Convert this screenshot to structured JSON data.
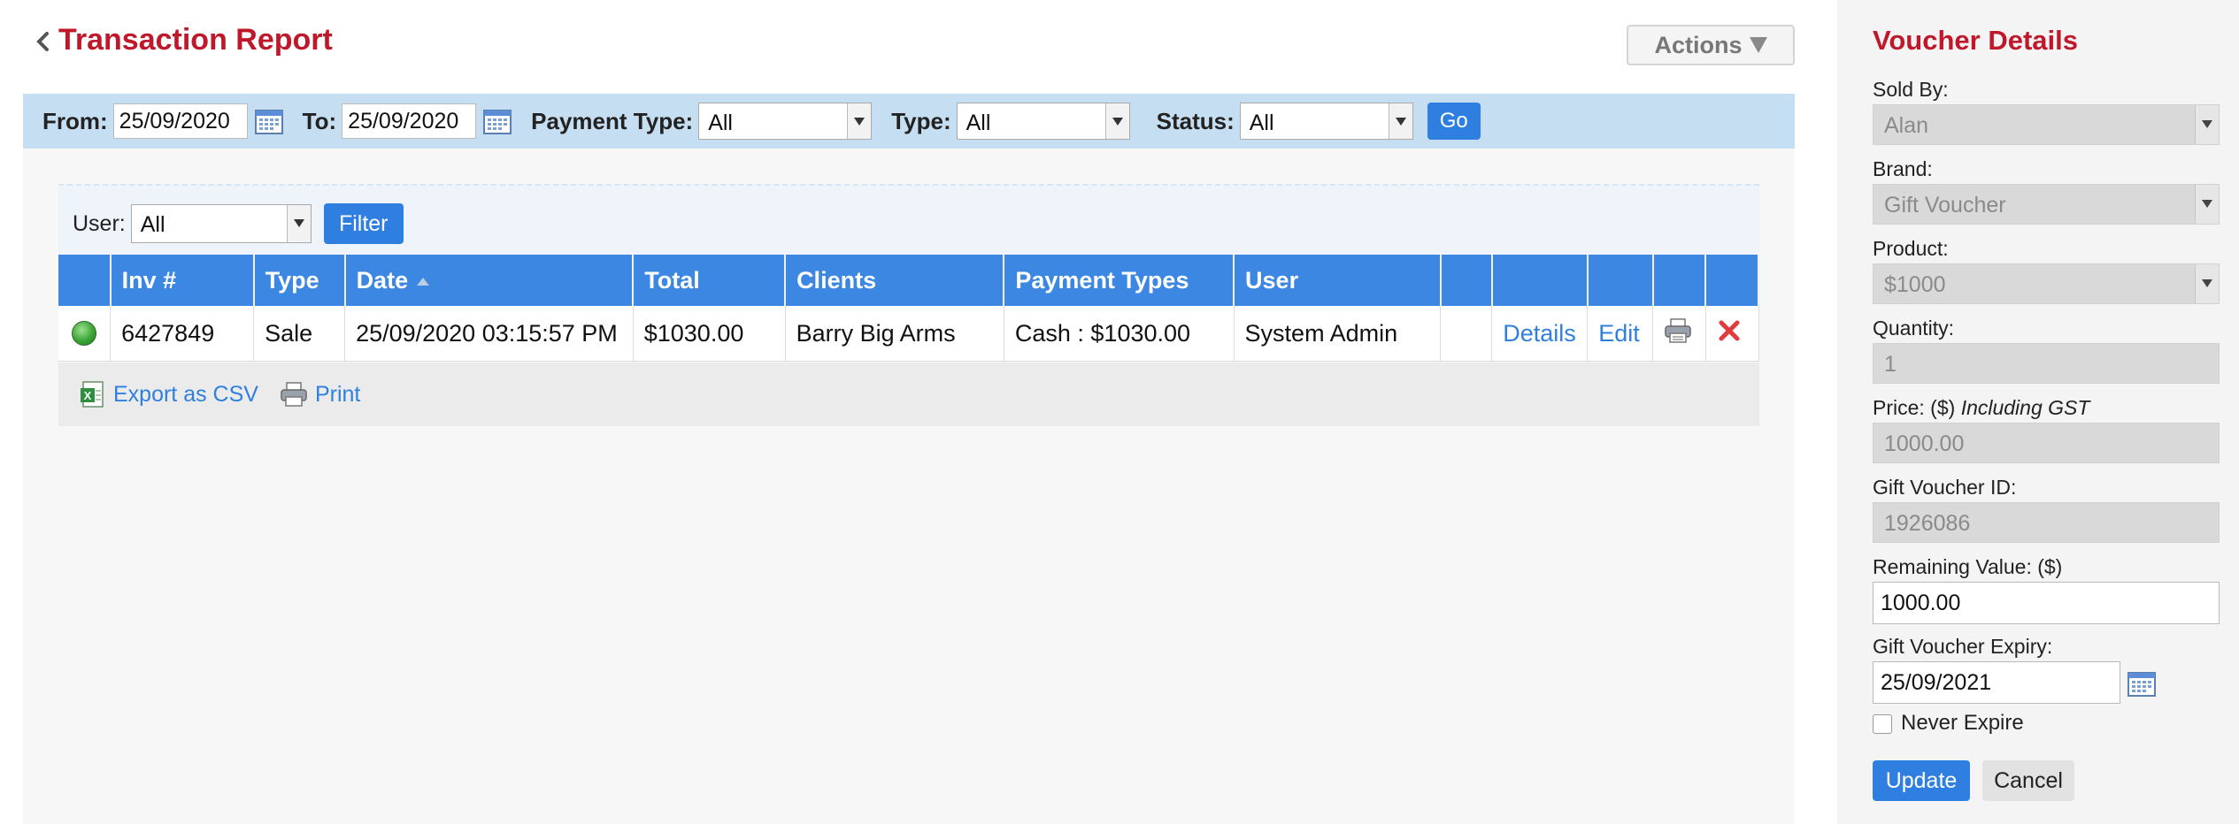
{
  "header": {
    "title": "Transaction Report",
    "actions_label": "Actions"
  },
  "filters": {
    "from_label": "From:",
    "from_value": "25/09/2020",
    "to_label": "To:",
    "to_value": "25/09/2020",
    "payment_type_label": "Payment Type:",
    "payment_type_value": "All",
    "type_label": "Type:",
    "type_value": "All",
    "status_label": "Status:",
    "status_value": "All",
    "go_label": "Go"
  },
  "user_filter": {
    "label": "User:",
    "value": "All",
    "button_label": "Filter"
  },
  "table": {
    "columns": [
      "",
      "Inv #",
      "Type",
      "Date",
      "Total",
      "Clients",
      "Payment Types",
      "User",
      "",
      "",
      "",
      "",
      ""
    ],
    "rows": [
      {
        "status": "green",
        "inv": "6427849",
        "type": "Sale",
        "date": "25/09/2020 03:15:57 PM",
        "total": "$1030.00",
        "client": "Barry Big Arms",
        "payment": "Cash : $1030.00",
        "user": "System Admin",
        "details_label": "Details",
        "edit_label": "Edit"
      }
    ]
  },
  "export": {
    "csv_label": "Export as CSV",
    "print_label": "Print"
  },
  "voucher": {
    "title": "Voucher Details",
    "sold_by_label": "Sold By:",
    "sold_by_value": "Alan",
    "brand_label": "Brand:",
    "brand_value": "Gift Voucher",
    "product_label": "Product:",
    "product_value": "$1000",
    "quantity_label": "Quantity:",
    "quantity_value": "1",
    "price_label": "Price: ($)",
    "price_note": "Including GST",
    "price_value": "1000.00",
    "gv_id_label": "Gift Voucher ID:",
    "gv_id_value": "1926086",
    "remaining_label": "Remaining Value: ($)",
    "remaining_value": "1000.00",
    "expiry_label": "Gift Voucher Expiry:",
    "expiry_value": "25/09/2021",
    "never_expire_label": "Never Expire",
    "update_label": "Update",
    "cancel_label": "Cancel"
  },
  "colors": {
    "title_red": "#c0182b",
    "accent_blue": "#2f7fe0",
    "header_blue": "#3b87e2",
    "filter_bar": "#c6def1"
  }
}
